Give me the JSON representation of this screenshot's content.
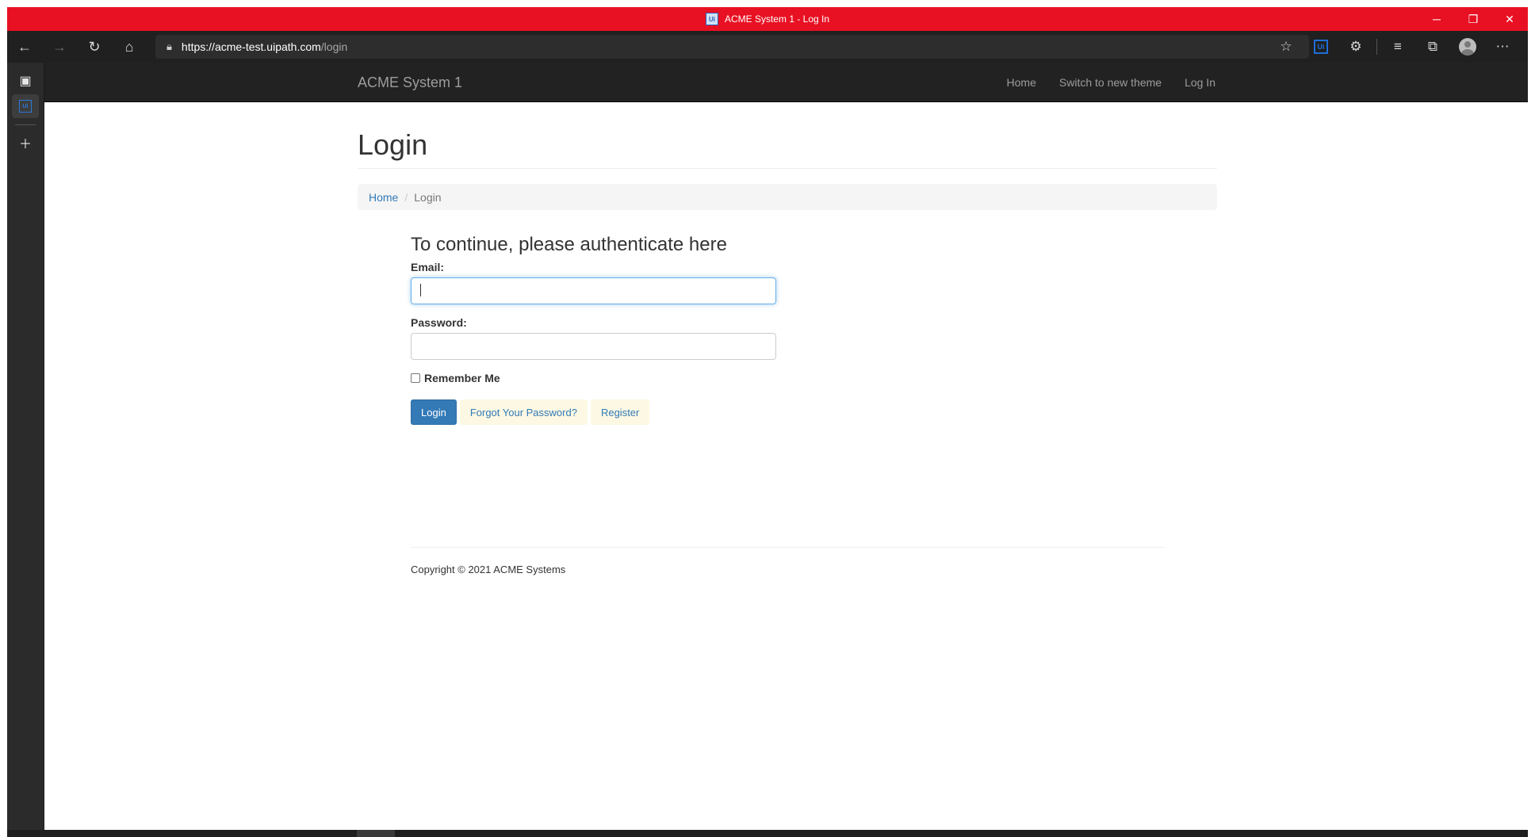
{
  "browser": {
    "window_title": "ACME System 1 - Log In",
    "tab_icon_text": "Ui",
    "url_host": "https://acme-test.uipath.com",
    "url_path": "/login",
    "colors": {
      "titlebar": "#e81123",
      "toolbar": "#202020"
    }
  },
  "site": {
    "brand": "ACME System 1",
    "nav": {
      "home": "Home",
      "switch_theme": "Switch to new theme",
      "login": "Log In"
    }
  },
  "page": {
    "title": "Login",
    "breadcrumb": {
      "home": "Home",
      "separator": "/",
      "current": "Login"
    }
  },
  "form": {
    "heading": "To continue, please authenticate here",
    "email_label": "Email:",
    "email_value": "",
    "password_label": "Password:",
    "password_value": "",
    "remember_label": "Remember Me",
    "remember_checked": false,
    "login_button": "Login",
    "forgot_link": "Forgot Your Password?",
    "register_link": "Register"
  },
  "footer": {
    "copyright": "Copyright © 2021 ACME Systems"
  }
}
